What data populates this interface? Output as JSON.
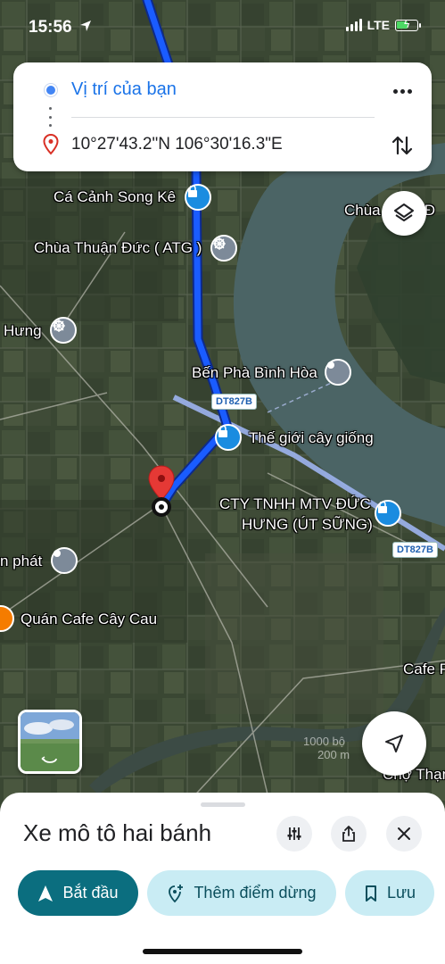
{
  "status_bar": {
    "time": "15:56",
    "network": "LTE"
  },
  "directions": {
    "origin": "Vị trí của bạn",
    "destination": "10°27'43.2\"N 106°30'16.3\"E",
    "more_icon": "more-horizontal-icon",
    "swap_icon": "swap-vertical-icon"
  },
  "map": {
    "labels": {
      "ca_canh_song_ke": "Cá Cảnh Song Kê",
      "chua_thuan_duc": "Chùa Thuận Đức ( ATG )",
      "chua_right": "Chùa Ngọc Đ",
      "hung": "Hưng",
      "ben_pha_binh_hoa": "Bến Phà Bình Hòa",
      "the_gioi_cay_giong": "Thế giới cây giống",
      "cty_line1": "CTY TNHH MTV ĐỨC",
      "cty_line2": "HƯNG (ÚT SỮNG)",
      "an_phat": "n phát",
      "quan_cafe": "Quán Cafe Cây Cau",
      "cafe_right": "Cafe P",
      "cho_thanh": "Chợ Thạn"
    },
    "road_shields": {
      "dt827b_1": "DT827B",
      "dt827b_2": "DT827B"
    },
    "scale_text": "1000 bộ\n200 m",
    "route_color": "#1a5cff"
  },
  "sheet": {
    "title": "Xe mô tô hai bánh",
    "buttons": {
      "start": "Bắt đầu",
      "add_stop": "Thêm điểm dừng",
      "save": "Lưu"
    }
  },
  "colors": {
    "primary": "#0b6e7f",
    "secondary": "#c9ecf4",
    "link": "#1a73e8"
  }
}
